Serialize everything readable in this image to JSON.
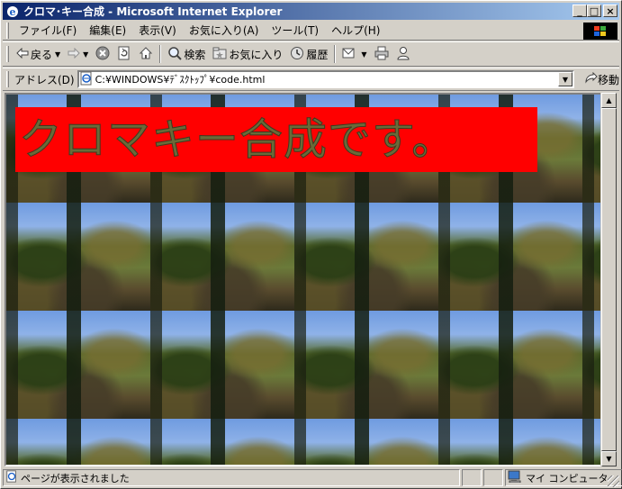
{
  "window": {
    "title": "クロマ･キー合成 - Microsoft Internet Explorer",
    "minimize": "_",
    "maximize": "□",
    "close": "×"
  },
  "menu": {
    "items": [
      "ファイル(F)",
      "編集(E)",
      "表示(V)",
      "お気に入り(A)",
      "ツール(T)",
      "ヘルプ(H)"
    ]
  },
  "toolbar": {
    "back": "戻る",
    "search": "検索",
    "favorites": "お気に入り",
    "history": "履歴"
  },
  "address": {
    "label": "アドレス(D)",
    "url": "C:¥WINDOWS¥ﾃﾞｽｸﾄｯﾌﾟ¥code.html",
    "go": "移動"
  },
  "page": {
    "banner_text": "クロマキー合成です。"
  },
  "status": {
    "message": "ページが表示されました",
    "zone": "マイ コンピュータ"
  },
  "colors": {
    "titlebar_start": "#0a246a",
    "titlebar_end": "#a6caf0",
    "banner_bg": "#ff0000",
    "chrome": "#d4d0c8"
  }
}
